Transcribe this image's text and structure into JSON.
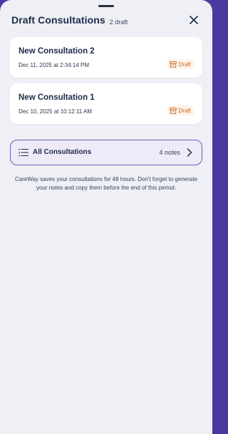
{
  "header": {
    "title": "Draft Consultations",
    "count_label": "2 draft"
  },
  "drafts": [
    {
      "name": "New Consultation 2",
      "date": "Dec 11, 2025 at 2:34:14 PM",
      "status": "Draft"
    },
    {
      "name": "New Consultation 1",
      "date": "Dec 10, 2025 at 10:12:11 AM",
      "status": "Draft"
    }
  ],
  "all_consultations": {
    "label": "All Consultations",
    "count": "4 notes"
  },
  "info": "CareWay saves your consultations for 48 hours. Don't forget to generate your notes and copy them before the end of this period.",
  "colors": {
    "accent": "#6f5bb3",
    "badge_bg": "#fdf3ea",
    "badge_text": "#c9651f",
    "sheet_bg": "#eef0f6"
  },
  "icons": {
    "close": "close-icon",
    "draft_badge": "archive-box-icon",
    "list": "list-icon",
    "chevron": "chevron-right-icon"
  }
}
